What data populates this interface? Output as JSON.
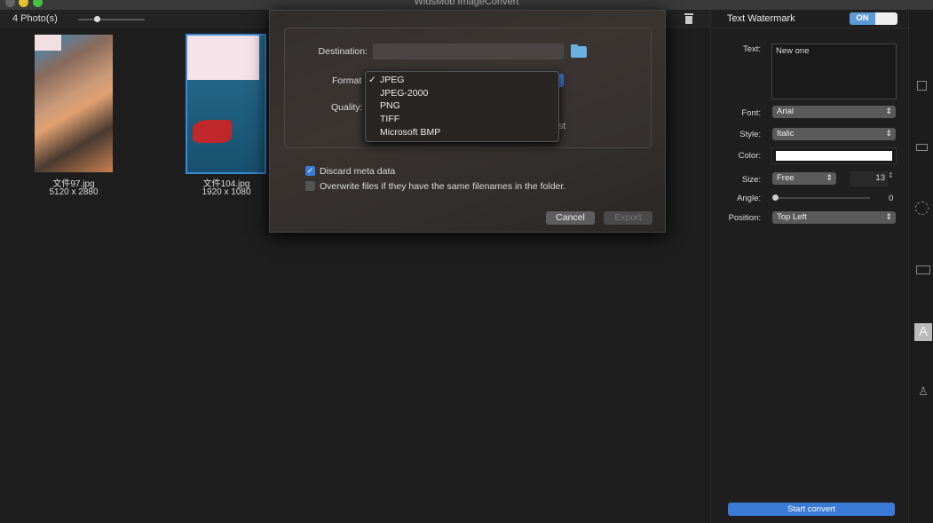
{
  "window": {
    "title": "WidsMob ImageConvert"
  },
  "toolbar": {
    "photo_count": "4 Photo(s)",
    "zoom_level": 0.3
  },
  "photos": [
    {
      "name": "文件97.jpg",
      "dims": "5120 x 2880",
      "selected": false
    },
    {
      "name": "文件104.jpg",
      "dims": "1920 x 1080",
      "selected": true
    }
  ],
  "dialog": {
    "destination_label": "Destination:",
    "destination_value": "",
    "format_label": "Format",
    "quality_label": "Quality:",
    "format_options": [
      "JPEG",
      "JPEG-2000",
      "PNG",
      "TIFF",
      "Microsoft BMP"
    ],
    "format_selected": "JPEG",
    "checkmark": "✓",
    "hidden_text_fragment": "st",
    "discard_meta_label": "Discard meta data",
    "discard_meta_checked": true,
    "overwrite_label": "Overwrite files if they have the same filenames in the folder.",
    "overwrite_checked": false,
    "cancel_label": "Cancel",
    "export_label": "Export"
  },
  "watermark": {
    "title": "Text Watermark",
    "toggle_label": "ON",
    "enabled": true,
    "text_label": "Text:",
    "text_value": "New one",
    "font_label": "Font:",
    "font_value": "Arial",
    "style_label": "Style:",
    "style_value": "Italic",
    "color_label": "Color:",
    "color_value": "#ffffff",
    "size_label": "Size:",
    "size_mode": "Free",
    "size_value": "13",
    "angle_label": "Angle:",
    "angle_value": "0",
    "position_label": "Position:",
    "position_value": "Top Left",
    "start_label": "Start convert"
  },
  "colors": {
    "accent": "#3b7bd8",
    "toggle": "#5b9bd5"
  },
  "side_icons": [
    "resize-icon",
    "crop-icon",
    "rotate-icon",
    "border-icon",
    "text-watermark-icon",
    "stamp-icon"
  ]
}
